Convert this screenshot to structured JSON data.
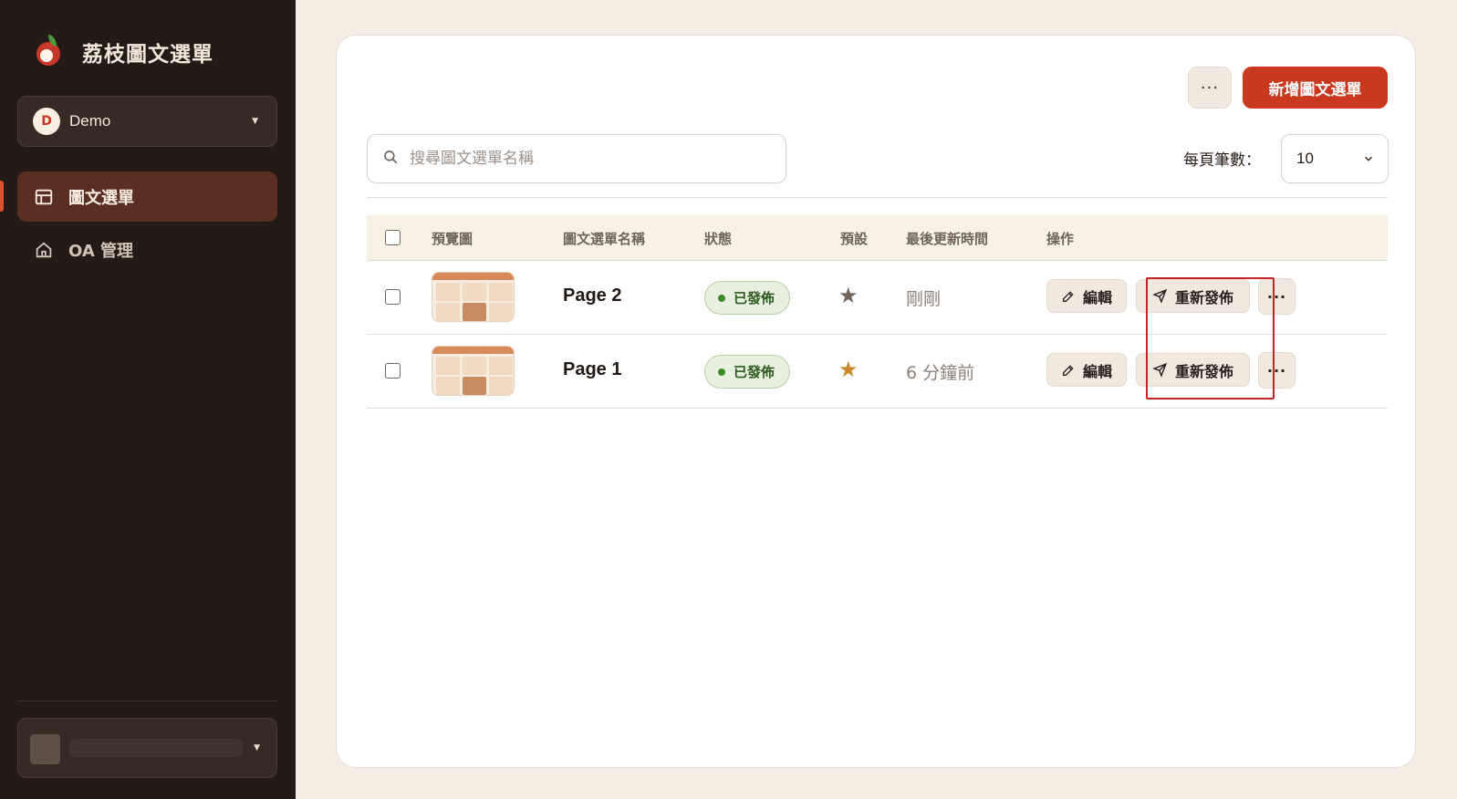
{
  "app": {
    "brand": "荔枝圖文選單"
  },
  "workspace": {
    "avatar_letter": "D",
    "name": "Demo"
  },
  "nav": {
    "items": [
      {
        "label": "圖文選單",
        "icon": "layout-icon",
        "active": true
      },
      {
        "label": "OA 管理",
        "icon": "home-icon",
        "active": false
      }
    ]
  },
  "toolbar": {
    "more_label": "···",
    "add_label": "新增圖文選單"
  },
  "search": {
    "placeholder": "搜尋圖文選單名稱",
    "value": ""
  },
  "pagination": {
    "per_page_label": "每頁筆數：",
    "per_page_value": "10"
  },
  "table": {
    "headers": {
      "preview": "預覽圖",
      "name": "圖文選單名稱",
      "status": "狀態",
      "default": "預設",
      "updated": "最後更新時間",
      "actions": "操作"
    },
    "rows": [
      {
        "name": "Page 2",
        "status": "已發佈",
        "is_default": false,
        "updated": "剛剛",
        "edit_label": "編輯",
        "republish_label": "重新發佈",
        "more_label": "···"
      },
      {
        "name": "Page 1",
        "status": "已發佈",
        "is_default": true,
        "updated": "6 分鐘前",
        "edit_label": "編輯",
        "republish_label": "重新發佈",
        "more_label": "···"
      }
    ]
  },
  "colors": {
    "accent": "#c8391f",
    "sidebar_bg": "#241b17",
    "active_nav_bg": "#5a2f22",
    "published_green": "#3f8a2a",
    "default_star": "#c98a2a",
    "highlight_box": "#c7222a"
  }
}
